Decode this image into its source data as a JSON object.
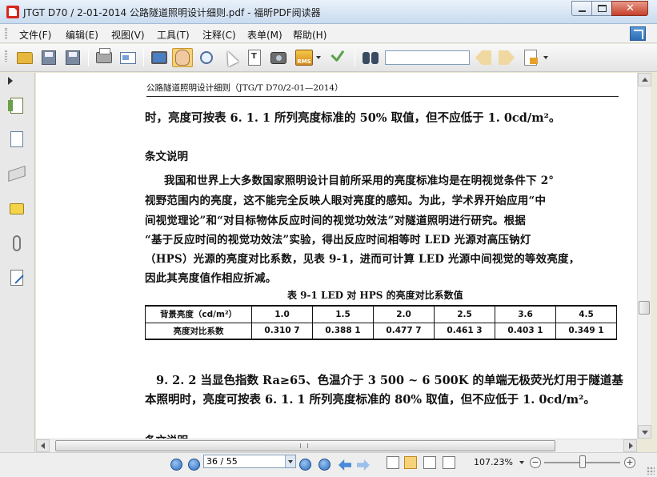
{
  "window": {
    "title": "JTGT D70 / 2-01-2014 公路隧道照明设计细则.pdf - 福昕PDF阅读器"
  },
  "menu": [
    "文件(F)",
    "编辑(E)",
    "视图(V)",
    "工具(T)",
    "注释(C)",
    "表单(M)",
    "帮助(H)"
  ],
  "toolbar": {
    "buttons": [
      "open-icon",
      "save-icon",
      "save-as-icon",
      "print-icon",
      "scan-icon",
      "fullscreen-icon",
      "hand-tool-icon",
      "zoom-tool-icon",
      "select-tool-icon",
      "text-select-icon",
      "snapshot-icon",
      "rms-icon",
      "sign-icon",
      "find-icon",
      "prev-result-icon",
      "next-result-icon",
      "highlight-doc-icon"
    ],
    "active": "hand-tool-icon",
    "rms_label": "RMS",
    "search_value": ""
  },
  "document": {
    "running_head": "公路隧道照明设计细则（JTG/T  D70/2-01—2014）",
    "line1": "时，亮度可按表 6. 1. 1 所列亮度标准的 50% 取值，但不应低于 1. 0cd/m²。",
    "section_title": "条文说明",
    "para": [
      "我国和世界上大多数国家照明设计目前所采用的亮度标准均是在明视觉条件下 2°",
      "视野范围内的亮度，这不能完全反映人眼对亮度的感知。为此，学术界开始应用“中",
      "间视觉理论”和“对目标物体反应时间的视觉功效法”对隧道照明进行研究。根据",
      "“基于反应时间的视觉功效法”实验，得出反应时间相等时 LED 光源对高压钠灯",
      "（HPS）光源的亮度对比系数，见表 9-1，进而可计算 LED 光源中间视觉的等效亮度，",
      "因此其亮度值作相应折减。"
    ],
    "table": {
      "caption": "表 9-1    LED 对 HPS 的亮度对比系数值",
      "row1_label": "背景亮度（cd/m²）",
      "row2_label": "亮度对比系数",
      "background_luminance": [
        "1.0",
        "1.5",
        "2.0",
        "2.5",
        "3.6",
        "4.5"
      ],
      "contrast_coefficient": [
        "0.310 7",
        "0.388 1",
        "0.477 7",
        "0.461 3",
        "0.403 1",
        "0.349 1"
      ]
    },
    "clause_922": [
      "9. 2. 2   当显色指数 Ra≥65、色温介于 3 500 ~ 6 500K 的单端无极荧光灯用于隧道基",
      "本照明时，亮度可按表 6. 1. 1 所列亮度标准的 80% 取值，但不应低于 1. 0cd/m²。"
    ],
    "partial_heading": "条文说明"
  },
  "statusbar": {
    "page_indicator": "36 / 55",
    "zoom": "107.23%",
    "zoom_minus": "−",
    "zoom_plus": "+"
  }
}
